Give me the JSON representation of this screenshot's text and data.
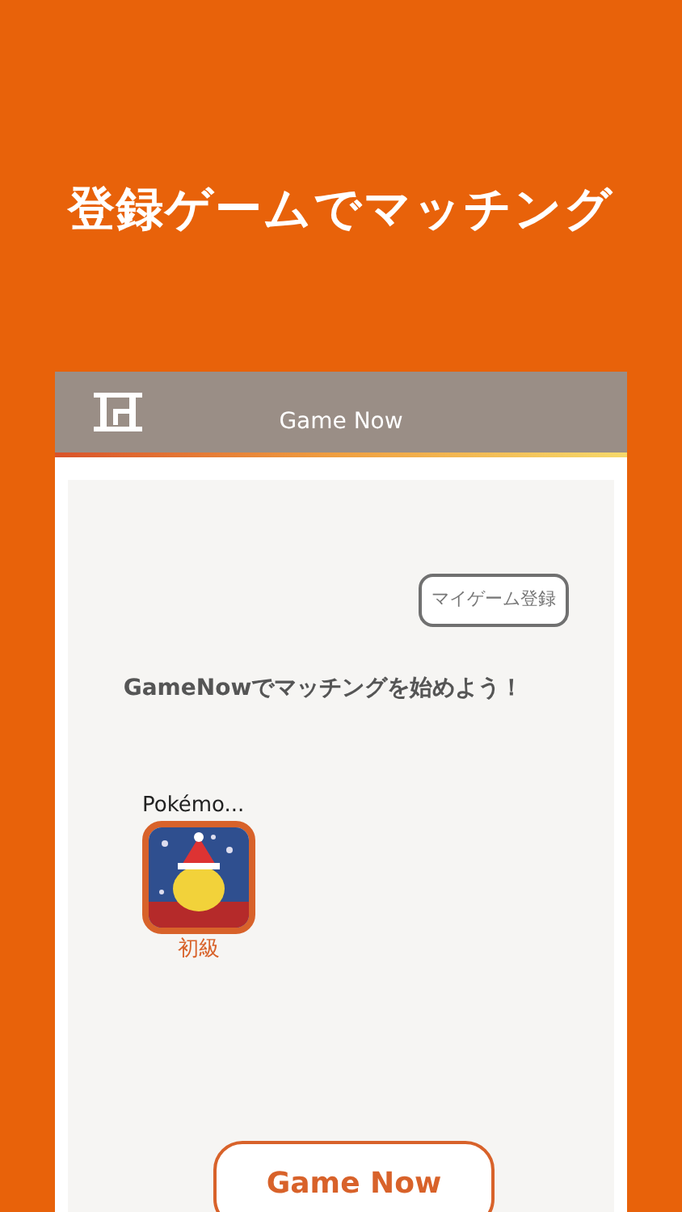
{
  "headline": "登録ゲームでマッチング",
  "app": {
    "header": {
      "title": "Game Now"
    },
    "register_button": "マイゲーム登録",
    "message": "GameNowでマッチングを始めよう！",
    "games": [
      {
        "title": "Pokémo...",
        "level_label": "初級",
        "kind": "picture"
      }
    ],
    "action_button": "Game Now"
  }
}
